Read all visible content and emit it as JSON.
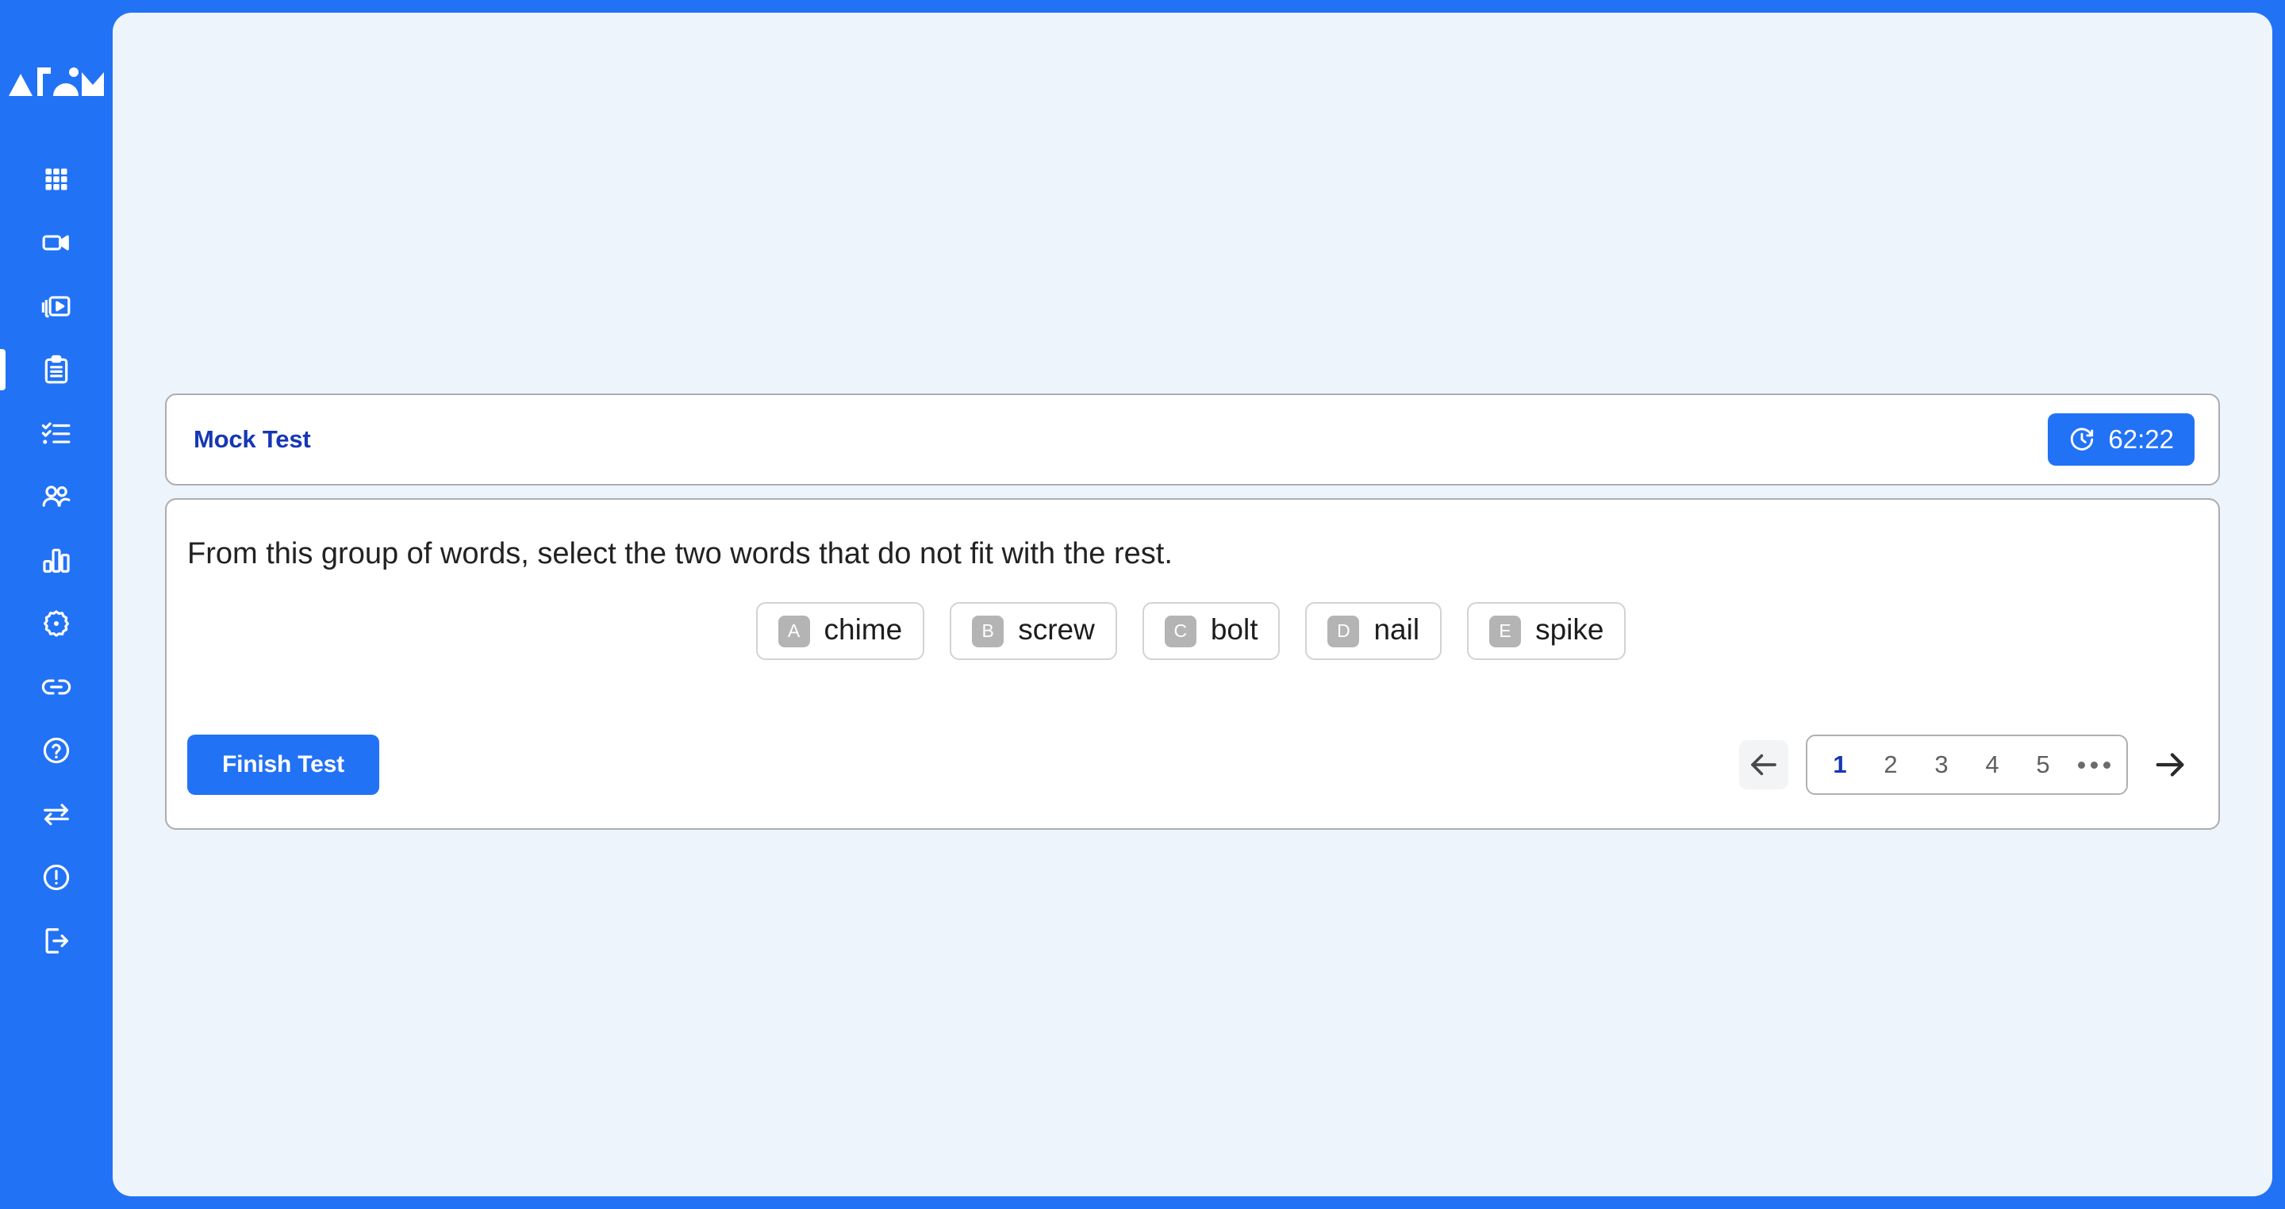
{
  "brand": {
    "logo_text": "Atom",
    "logo_icon": "atom-wordmark-logo",
    "accent_color": "#2272f5",
    "panel_background": "#eef4fc",
    "title_color": "#1637b5"
  },
  "sidebar": {
    "items": [
      {
        "icon": "grid-apps-icon",
        "name": "sidebar-item-dashboard",
        "active": false
      },
      {
        "icon": "video-camera-icon",
        "name": "sidebar-item-live-classes",
        "active": false
      },
      {
        "icon": "video-library-icon",
        "name": "sidebar-item-recordings",
        "active": false
      },
      {
        "icon": "clipboard-list-icon",
        "name": "sidebar-item-tests",
        "active": true
      },
      {
        "icon": "checklist-icon",
        "name": "sidebar-item-assignments",
        "active": false
      },
      {
        "icon": "users-icon",
        "name": "sidebar-item-students",
        "active": false
      },
      {
        "icon": "bar-chart-icon",
        "name": "sidebar-item-reports",
        "active": false
      },
      {
        "icon": "gear-icon",
        "name": "sidebar-item-settings",
        "active": false
      },
      {
        "icon": "link-icon",
        "name": "sidebar-item-links",
        "active": false
      },
      {
        "icon": "question-circle-icon",
        "name": "sidebar-item-help",
        "active": false
      },
      {
        "icon": "transfer-arrows-icon",
        "name": "sidebar-item-switch",
        "active": false
      },
      {
        "icon": "alert-circle-icon",
        "name": "sidebar-item-alerts",
        "active": false
      },
      {
        "icon": "logout-icon",
        "name": "sidebar-item-logout",
        "active": false
      }
    ]
  },
  "test": {
    "title": "Mock Test",
    "timer": {
      "icon": "timer-icon",
      "value": "62:22"
    }
  },
  "question": {
    "prompt": "From this group of words, select the two words that do not fit with the rest.",
    "options": [
      {
        "letter": "A",
        "word": "chime"
      },
      {
        "letter": "B",
        "word": "screw"
      },
      {
        "letter": "C",
        "word": "bolt"
      },
      {
        "letter": "D",
        "word": "nail"
      },
      {
        "letter": "E",
        "word": "spike"
      }
    ]
  },
  "footer": {
    "finish_label": "Finish Test",
    "pagination": {
      "prev_icon": "arrow-left-icon",
      "next_icon": "arrow-right-icon",
      "pages": [
        "1",
        "2",
        "3",
        "4",
        "5"
      ],
      "active_page": "1",
      "ellipsis": "•••"
    }
  }
}
